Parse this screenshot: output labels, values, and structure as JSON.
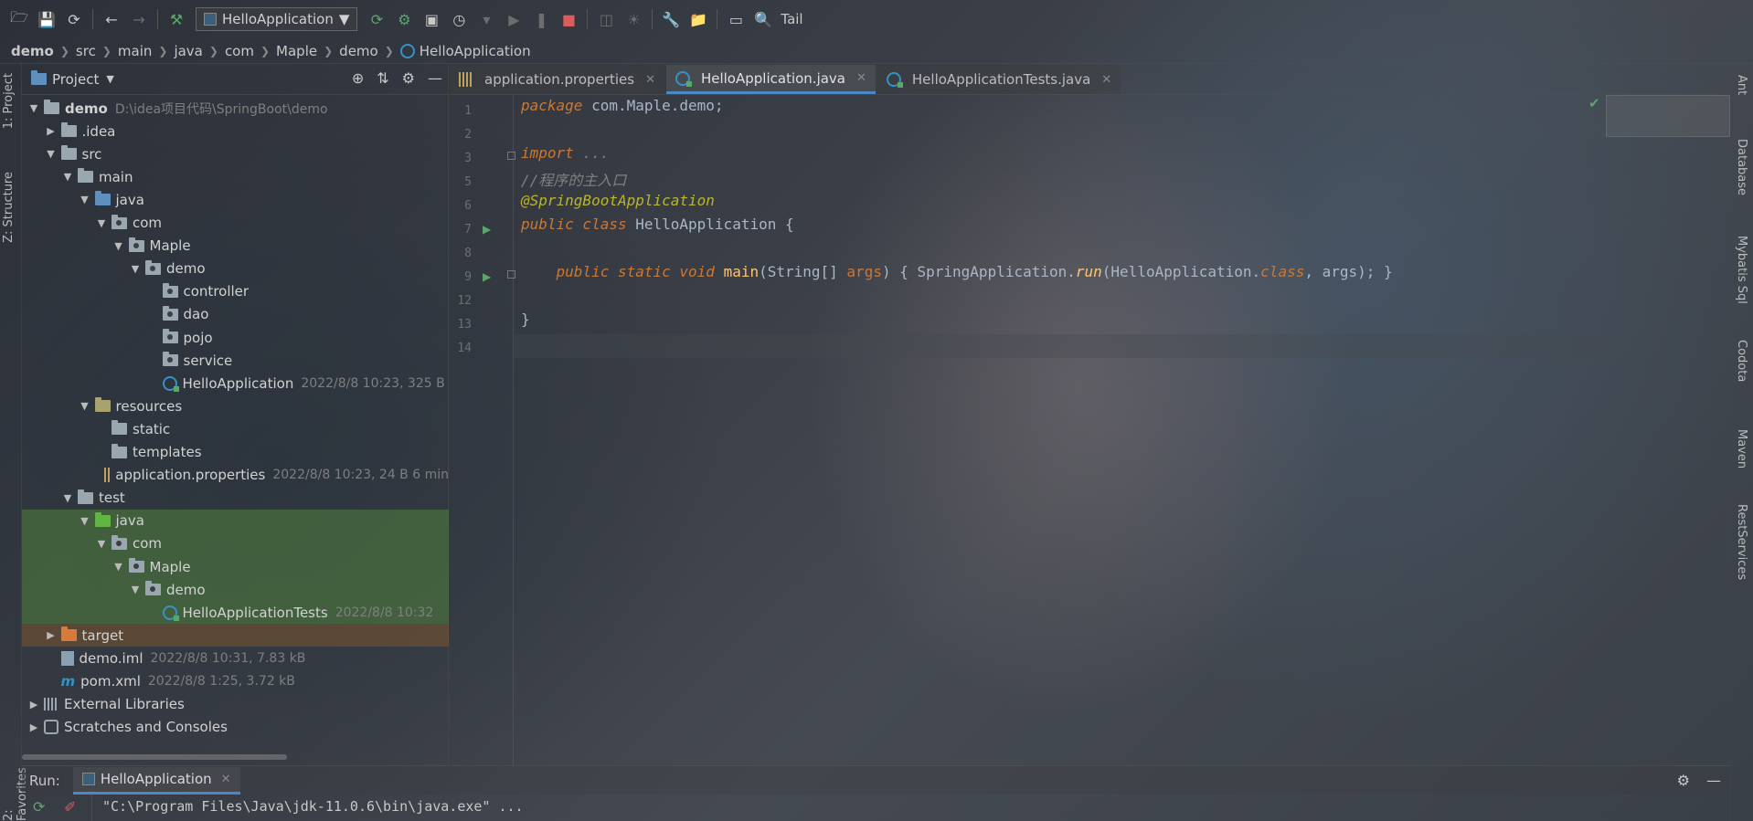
{
  "toolbar": {
    "run_config": "HelloApplication",
    "tail_label": "Tail"
  },
  "breadcrumb": [
    "demo",
    "src",
    "main",
    "java",
    "com",
    "Maple",
    "demo",
    "HelloApplication"
  ],
  "left_strip": {
    "project": "1: Project",
    "structure": "Z: Structure",
    "favorites": "2: Favorites"
  },
  "right_strip": [
    "Ant",
    "Database",
    "Mybatis Sql",
    "Codota",
    "Maven",
    "RestServices"
  ],
  "project_panel": {
    "title": "Project",
    "tree": [
      {
        "label": "demo",
        "meta": "D:\\idea项目代码\\SpringBoot\\demo",
        "depth": 0,
        "arrow": "▼",
        "icon": "folder",
        "bold": true
      },
      {
        "label": ".idea",
        "meta": "",
        "depth": 1,
        "arrow": "▶",
        "icon": "folder"
      },
      {
        "label": "src",
        "meta": "",
        "depth": 1,
        "arrow": "▼",
        "icon": "folder"
      },
      {
        "label": "main",
        "meta": "",
        "depth": 2,
        "arrow": "▼",
        "icon": "folder"
      },
      {
        "label": "java",
        "meta": "",
        "depth": 3,
        "arrow": "▼",
        "icon": "folder src"
      },
      {
        "label": "com",
        "meta": "",
        "depth": 4,
        "arrow": "▼",
        "icon": "folder pkg"
      },
      {
        "label": "Maple",
        "meta": "",
        "depth": 5,
        "arrow": "▼",
        "icon": "folder pkg"
      },
      {
        "label": "demo",
        "meta": "",
        "depth": 6,
        "arrow": "▼",
        "icon": "folder pkg"
      },
      {
        "label": "controller",
        "meta": "",
        "depth": 7,
        "arrow": "",
        "icon": "folder pkg"
      },
      {
        "label": "dao",
        "meta": "",
        "depth": 7,
        "arrow": "",
        "icon": "folder pkg"
      },
      {
        "label": "pojo",
        "meta": "",
        "depth": 7,
        "arrow": "",
        "icon": "folder pkg"
      },
      {
        "label": "service",
        "meta": "",
        "depth": 7,
        "arrow": "",
        "icon": "folder pkg"
      },
      {
        "label": "HelloApplication",
        "meta": "2022/8/8 10:23, 325 B",
        "depth": 7,
        "arrow": "",
        "icon": "class"
      },
      {
        "label": "resources",
        "meta": "",
        "depth": 3,
        "arrow": "▼",
        "icon": "folder res"
      },
      {
        "label": "static",
        "meta": "",
        "depth": 4,
        "arrow": "",
        "icon": "folder"
      },
      {
        "label": "templates",
        "meta": "",
        "depth": 4,
        "arrow": "",
        "icon": "folder"
      },
      {
        "label": "application.properties",
        "meta": "2022/8/8 10:23, 24 B 6 min",
        "depth": 4,
        "arrow": "",
        "icon": "props"
      },
      {
        "label": "test",
        "meta": "",
        "depth": 2,
        "arrow": "▼",
        "icon": "folder"
      },
      {
        "label": "java",
        "meta": "",
        "depth": 3,
        "arrow": "▼",
        "icon": "folder test",
        "hl": "test"
      },
      {
        "label": "com",
        "meta": "",
        "depth": 4,
        "arrow": "▼",
        "icon": "folder pkg",
        "hl": "test"
      },
      {
        "label": "Maple",
        "meta": "",
        "depth": 5,
        "arrow": "▼",
        "icon": "folder pkg",
        "hl": "test"
      },
      {
        "label": "demo",
        "meta": "",
        "depth": 6,
        "arrow": "▼",
        "icon": "folder pkg",
        "hl": "test"
      },
      {
        "label": "HelloApplicationTests",
        "meta": "2022/8/8 10:32",
        "depth": 7,
        "arrow": "",
        "icon": "class",
        "hl": "test"
      },
      {
        "label": "target",
        "meta": "",
        "depth": 1,
        "arrow": "▶",
        "icon": "folder excl",
        "hl": "target"
      },
      {
        "label": "demo.iml",
        "meta": "2022/8/8 10:31, 7.83 kB",
        "depth": 1,
        "arrow": "",
        "icon": "iml"
      },
      {
        "label": "pom.xml",
        "meta": "2022/8/8 1:25, 3.72 kB",
        "depth": 1,
        "arrow": "",
        "icon": "maven"
      },
      {
        "label": "External Libraries",
        "meta": "",
        "depth": 0,
        "arrow": "▶",
        "icon": "lib"
      },
      {
        "label": "Scratches and Consoles",
        "meta": "",
        "depth": 0,
        "arrow": "▶",
        "icon": "scratch"
      }
    ]
  },
  "editor": {
    "tabs": [
      {
        "label": "application.properties",
        "active": false,
        "icon": "props"
      },
      {
        "label": "HelloApplication.java",
        "active": true,
        "icon": "class"
      },
      {
        "label": "HelloApplicationTests.java",
        "active": false,
        "icon": "class"
      }
    ],
    "line_numbers": [
      "1",
      "2",
      "3",
      "5",
      "6",
      "7",
      "8",
      "9",
      "12",
      "13",
      "14"
    ],
    "code": {
      "l1_kw": "package",
      "l1_rest": " com.Maple.demo;",
      "l3_kw": "import",
      "l3_rest": " ...",
      "l5": "//程序的主入口",
      "l6": "@SpringBootApplication",
      "l7_kw": "public class",
      "l7_rest": " HelloApplication {",
      "l9_kw": "public static void",
      "l9_mth": "main",
      "l9_a": "(String[] ",
      "l9_b": "args",
      "l9_c": ") { SpringApplication.",
      "l9_run": "run",
      "l9_d": "(HelloApplication.",
      "l9_cls": "class",
      "l9_e": ", args); }",
      "l13": "}"
    }
  },
  "run_panel": {
    "label": "Run:",
    "tab": "HelloApplication",
    "console": "\"C:\\Program Files\\Java\\jdk-11.0.6\\bin\\java.exe\" ..."
  }
}
